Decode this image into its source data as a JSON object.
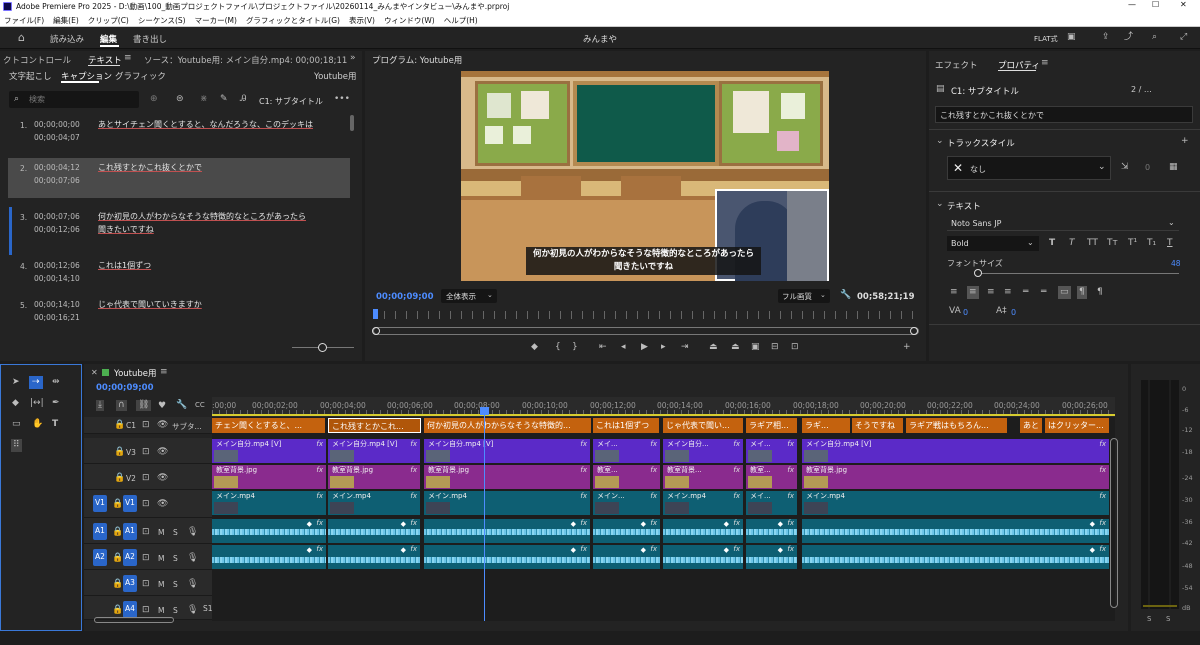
{
  "window": {
    "title": "Adobe Premiere Pro 2025 - D:\\動画\\100_動画プロジェクトファイル\\プロジェクトファイル\\20260114_みんまやインタビュー\\みんまや.prproj",
    "min": "—",
    "max": "☐",
    "close": "✕"
  },
  "menu": [
    "ファイル(F)",
    "編集(E)",
    "クリップ(C)",
    "シーケンス(S)",
    "マーカー(M)",
    "グラフィックとタイトル(G)",
    "表示(V)",
    "ウィンドウ(W)",
    "ヘルプ(H)"
  ],
  "workspace": {
    "tabs": [
      "読み込み",
      "編集",
      "書き出し"
    ],
    "active": "編集",
    "project": "みんまや",
    "flat": "FLAT式"
  },
  "left_panel": {
    "tabs": [
      "クトコントロール",
      "テキスト",
      "ソース：Youtube用: メイン自分.mp4: 00;00;18;11"
    ],
    "subtabs": [
      "文字起こし",
      "キャプション",
      "グラフィック"
    ],
    "sequence": "Youtube用",
    "search_placeholder": "検索",
    "track_label": "C1: サブタイトル",
    "captions": [
      {
        "num": "1.",
        "in": "00;00;00;00",
        "out": "00;00;04;07",
        "text": "あとサイチェン聞くとすると、なんだろうな、このデッキは",
        "text2": ""
      },
      {
        "num": "2.",
        "in": "00;00;04;12",
        "out": "00;00;07;06",
        "text": "これ残すとかこれ抜くとかで",
        "text2": ""
      },
      {
        "num": "3.",
        "in": "00;00;07;06",
        "out": "00;00;12;06",
        "text": "何か初見の人がわからなそうな特徴的なところがあったら",
        "text2": "聞きたいですね"
      },
      {
        "num": "4.",
        "in": "00;00;12;06",
        "out": "00;00;14;10",
        "text": "これは1個ずつ",
        "text2": ""
      },
      {
        "num": "5.",
        "in": "00;00;14;10",
        "out": "00;00;16;21",
        "text": "じゃ代表で聞いていきますか",
        "text2": ""
      }
    ]
  },
  "program": {
    "title": "プログラム: Youtube用",
    "subtitle1": "何か初見の人がわからなそうな特徴的なところがあったら",
    "subtitle2": "聞きたいですね",
    "timecode": "00;00;09;00",
    "fit": "全体表示",
    "quality": "フル画質",
    "duration": "00;58;21;19"
  },
  "right_panel": {
    "tabs": [
      "エフェクト",
      "プロパティ"
    ],
    "track_title": "C1: サブタイトル",
    "page": "2 / …",
    "caption_value": "これ残すとかこれ抜くとかで",
    "track_style": "トラックスタイル",
    "style_value": "なし",
    "style_count": "0",
    "text_section": "テキスト",
    "font": "Noto Sans JP",
    "weight": "Bold",
    "font_size_label": "フォントサイズ",
    "font_size": "48",
    "tracking1": "0",
    "tracking2": "0"
  },
  "timeline": {
    "sequence": "Youtube用",
    "timecode": "00;00;09;00",
    "ruler": [
      ":00;00",
      "00;00;02;00",
      "00;00;04;00",
      "00;00;06;00",
      "00;00;08;00",
      "00;00;10;00",
      "00;00;12;00",
      "00;00;14;00",
      "00;00;16;00",
      "00;00;18;00",
      "00;00;20;00",
      "00;00;22;00",
      "00;00;24;00",
      "00;00;26;00"
    ],
    "tracks": {
      "c1": "C1",
      "c1name": "サブタ...",
      "v3": "V3",
      "v2": "V2",
      "v1": "V1",
      "a1": "A1",
      "a2": "A2",
      "a3": "A3",
      "a4": "A4",
      "m": "M",
      "s": "S",
      "s1": "S1"
    },
    "captions": [
      "チェン聞くとすると、...",
      "これ残すとかこれ...",
      "何か初見の人がわからなそうな特徴的...",
      "これは1個ずつ",
      "じゃ代表で聞い...",
      "ラギア相...",
      "ラギ...",
      "そうですね",
      "ラギア戦はもちろん...",
      "あと",
      "はクリッター..."
    ],
    "v3_clips": [
      "メイン自分.mp4 [V]",
      "メイン自分.mp4 [V]",
      "メイン自分.mp4 [V]",
      "メイ...",
      "メイン自分...",
      "メイ...",
      "メイン自分.mp4 [V]"
    ],
    "v2_clips": [
      "教室背景.jpg",
      "教室背景.jpg",
      "教室背景.jpg",
      "教室...",
      "教室背景...",
      "教室...",
      "教室背景.jpg"
    ],
    "v1_clips": [
      "メイン.mp4",
      "メイン.mp4",
      "メイン.mp4",
      "メイン...",
      "メイン.mp4",
      "メイ...",
      "メイン.mp4"
    ],
    "fx": "fx"
  },
  "meter": {
    "labels": [
      "0",
      "-6",
      "-12",
      "-18",
      "-24",
      "-30",
      "-36",
      "-42",
      "-48",
      "-54",
      "dB"
    ],
    "s": "S"
  },
  "colors": {
    "caption": "#c4620e",
    "v3": "#5b2ac8",
    "v2": "#8a2b8e",
    "v1": "#0e5f73",
    "audio": "#0e5f73",
    "accent": "#2a66c9"
  }
}
